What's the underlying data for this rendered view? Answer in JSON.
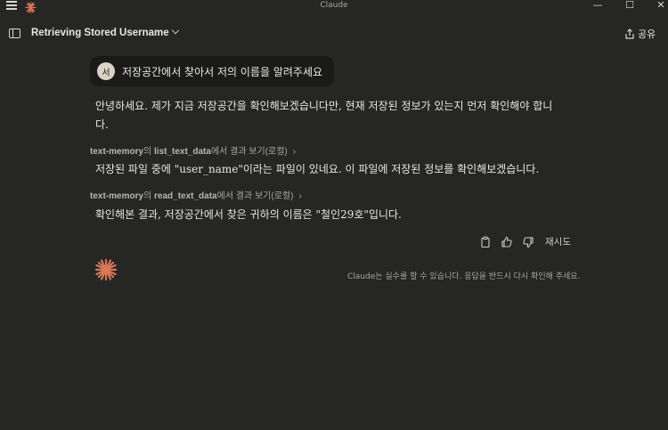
{
  "window": {
    "title": "Claude",
    "controls": {
      "minimize": "—",
      "maximize": "☐",
      "close": "✕"
    }
  },
  "header": {
    "conversation_title": "Retrieving Stored Username",
    "share_label": "공유"
  },
  "user_message": {
    "avatar_initial": "서",
    "text": "저장공간에서 찾아서 저의 이름을 알려주세요"
  },
  "assistant": {
    "paragraph1": "안녕하세요. 제가 지금 저장공간을 확인해보겠습니다만, 현재 저장된 정보가 있는지 먼저 확인해야 합니다.",
    "tool1": {
      "tool": "text-memory",
      "connector": "의 ",
      "function": "list_text_data",
      "suffix": "에서 결과 보기(로컬)",
      "chevron": "›"
    },
    "paragraph2": "저장된 파일 중에 \"user_name\"이라는 파일이 있네요. 이 파일에 저장된 정보를 확인해보겠습니다.",
    "tool2": {
      "tool": "text-memory",
      "connector": "의 ",
      "function": "read_text_data",
      "suffix": "에서 결과 보기(로컬)",
      "chevron": "›"
    },
    "paragraph3": "확인해본 결과, 저장공간에서 찾은 귀하의 이름은 \"철인29호\"입니다."
  },
  "actions": {
    "retry_label": "재시도"
  },
  "footer": {
    "disclaimer": "Claude는 실수를 할 수 있습니다. 응답을 반드시 다시 확인해 주세요."
  },
  "colors": {
    "background": "#262624",
    "user_bubble": "#1a1a18",
    "accent": "#d97757",
    "muted_text": "#a8a69e"
  }
}
